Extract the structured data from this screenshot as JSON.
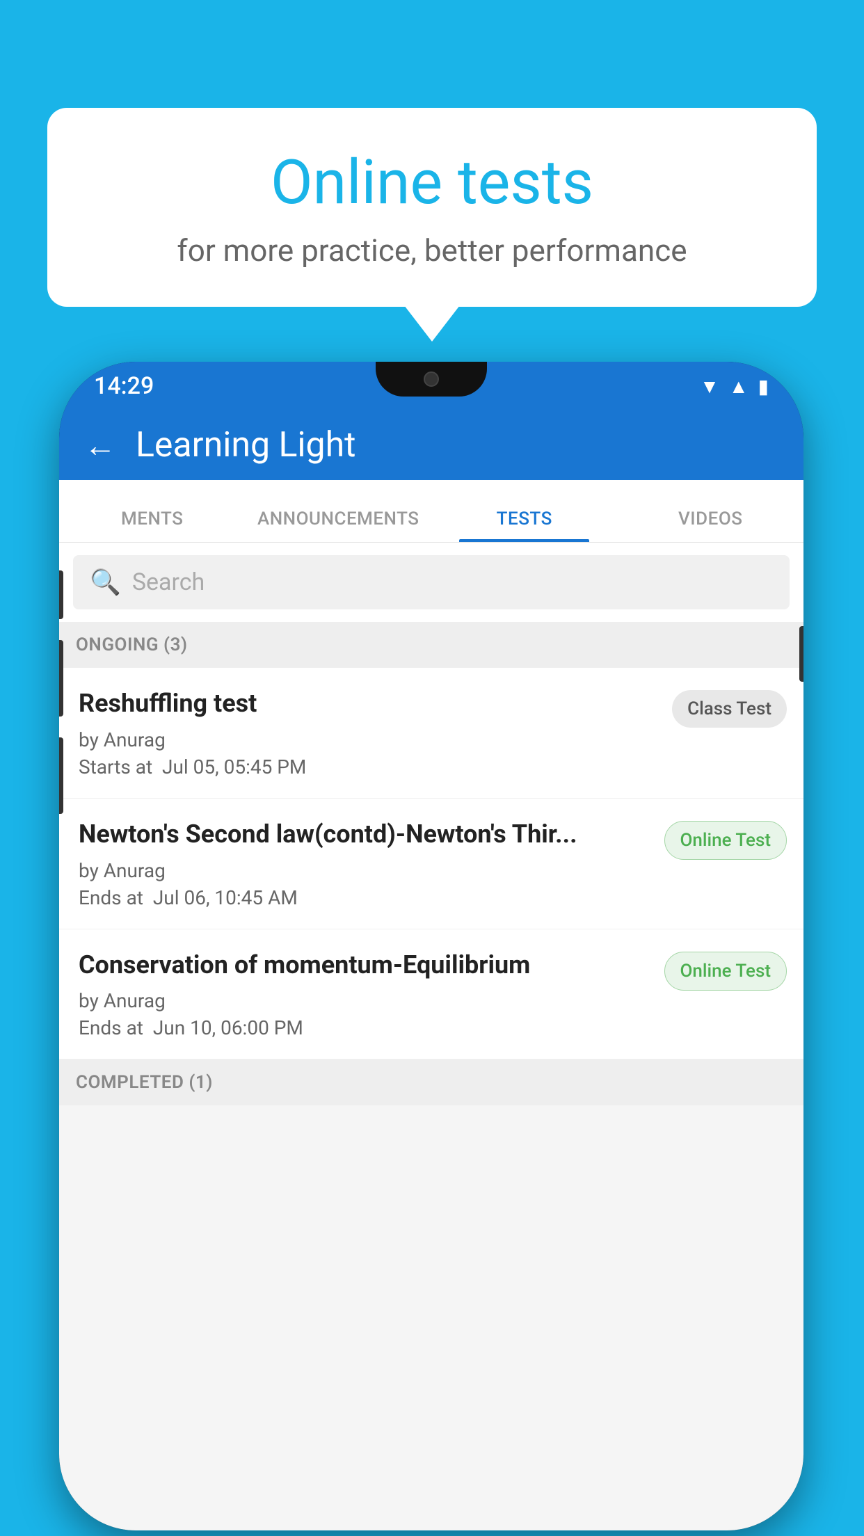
{
  "background": {
    "color": "#1ab4e8"
  },
  "speech_bubble": {
    "title": "Online tests",
    "subtitle": "for more practice, better performance"
  },
  "phone": {
    "status_bar": {
      "time": "14:29",
      "icons": [
        "wifi",
        "signal",
        "battery"
      ]
    },
    "app_bar": {
      "back_label": "←",
      "title": "Learning Light"
    },
    "tabs": [
      {
        "label": "MENTS",
        "active": false
      },
      {
        "label": "ANNOUNCEMENTS",
        "active": false
      },
      {
        "label": "TESTS",
        "active": true
      },
      {
        "label": "VIDEOS",
        "active": false
      }
    ],
    "search": {
      "placeholder": "Search"
    },
    "ongoing_section": {
      "label": "ONGOING (3)"
    },
    "tests": [
      {
        "name": "Reshuffling test",
        "by": "by Anurag",
        "date_label": "Starts at",
        "date": "Jul 05, 05:45 PM",
        "badge": "Class Test",
        "badge_type": "class"
      },
      {
        "name": "Newton's Second law(contd)-Newton's Thir...",
        "by": "by Anurag",
        "date_label": "Ends at",
        "date": "Jul 06, 10:45 AM",
        "badge": "Online Test",
        "badge_type": "online"
      },
      {
        "name": "Conservation of momentum-Equilibrium",
        "by": "by Anurag",
        "date_label": "Ends at",
        "date": "Jun 10, 06:00 PM",
        "badge": "Online Test",
        "badge_type": "online"
      }
    ],
    "completed_section": {
      "label": "COMPLETED (1)"
    }
  }
}
